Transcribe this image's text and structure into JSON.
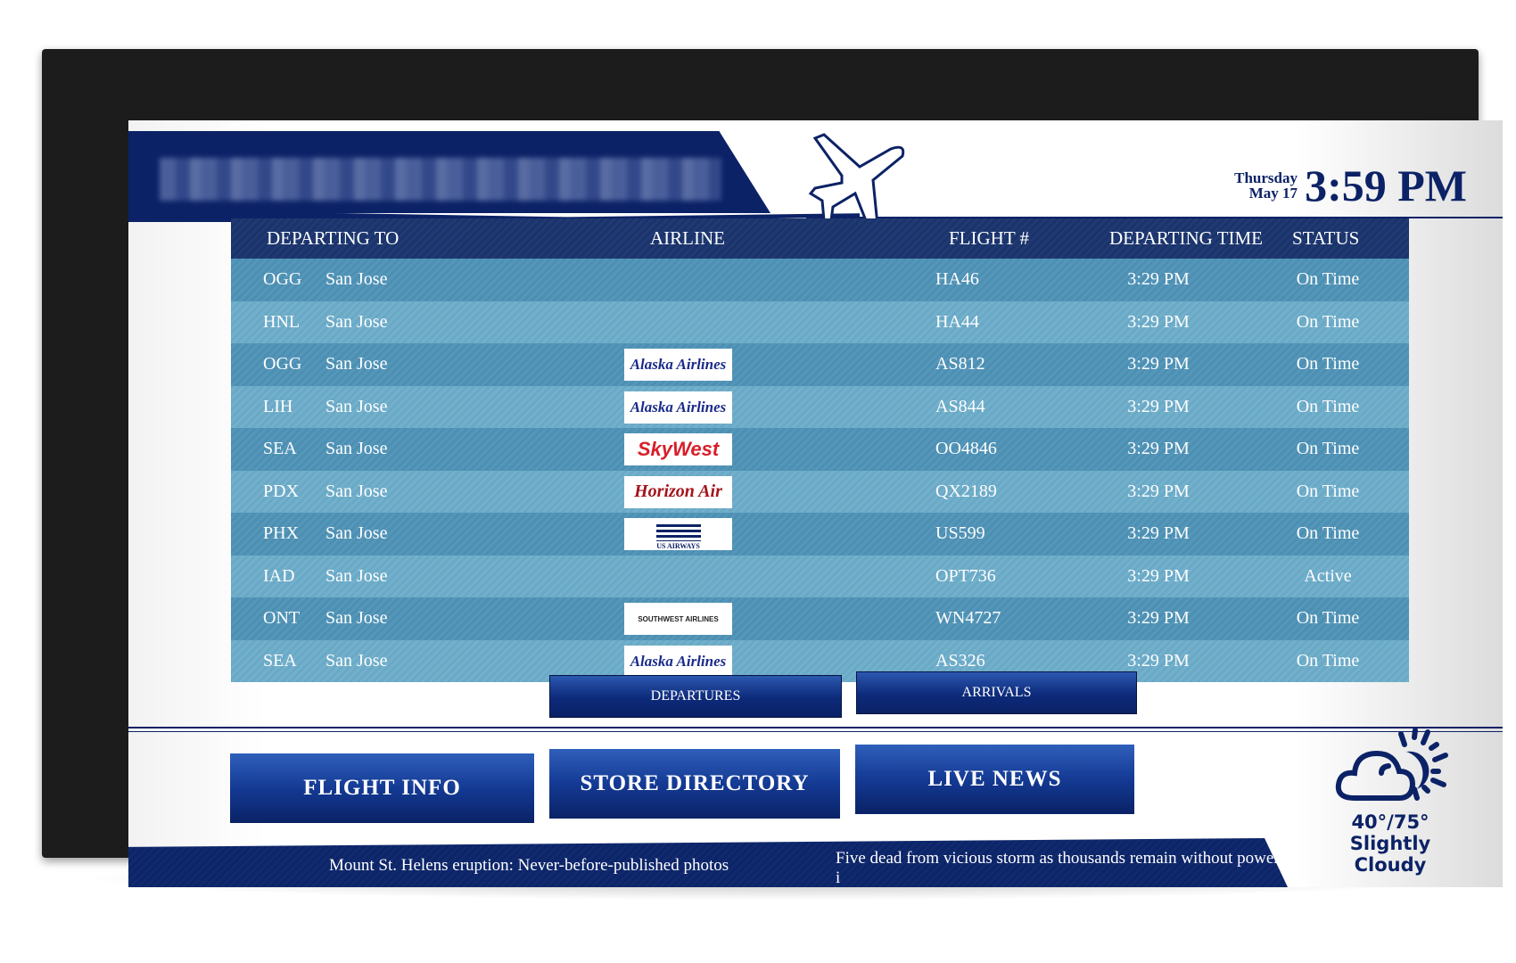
{
  "header": {
    "day": "Thursday",
    "date": "May 17",
    "time": "3:59 PM"
  },
  "table": {
    "columns": [
      "DEPARTING TO",
      "AIRLINE",
      "FLIGHT #",
      "DEPARTING TIME",
      "STATUS"
    ],
    "rows": [
      {
        "code": "OGG",
        "city": "San Jose",
        "airline": "",
        "flight": "HA46",
        "time": "3:29 PM",
        "status": "On Time"
      },
      {
        "code": "HNL",
        "city": "San Jose",
        "airline": "",
        "flight": "HA44",
        "time": "3:29 PM",
        "status": "On Time"
      },
      {
        "code": "OGG",
        "city": "San Jose",
        "airline": "Alaska Airlines",
        "flight": "AS812",
        "time": "3:29 PM",
        "status": "On Time"
      },
      {
        "code": "LIH",
        "city": "San Jose",
        "airline": "Alaska Airlines",
        "flight": "AS844",
        "time": "3:29 PM",
        "status": "On Time"
      },
      {
        "code": "SEA",
        "city": "San Jose",
        "airline": "SkyWest",
        "flight": "OO4846",
        "time": "3:29 PM",
        "status": "On Time"
      },
      {
        "code": "PDX",
        "city": "San Jose",
        "airline": "Horizon Air",
        "flight": "QX2189",
        "time": "3:29 PM",
        "status": "On Time"
      },
      {
        "code": "PHX",
        "city": "San Jose",
        "airline": "US AIRWAYS",
        "flight": "US599",
        "time": "3:29 PM",
        "status": "On Time"
      },
      {
        "code": "IAD",
        "city": "San Jose",
        "airline": "",
        "flight": "OPT736",
        "time": "3:29 PM",
        "status": "Active"
      },
      {
        "code": "ONT",
        "city": "San Jose",
        "airline": "SOUTHWEST AIRLINES",
        "flight": "WN4727",
        "time": "3:29 PM",
        "status": "On Time"
      },
      {
        "code": "SEA",
        "city": "San Jose",
        "airline": "Alaska Airlines",
        "flight": "AS326",
        "time": "3:29 PM",
        "status": "On Time"
      }
    ]
  },
  "tabs": {
    "departures": "DEPARTURES",
    "arrivals": "ARRIVALS"
  },
  "nav": {
    "flight_info": "FLIGHT INFO",
    "store_directory": "STORE DIRECTORY",
    "live_news": "LIVE NEWS"
  },
  "weather": {
    "icon": "partly-cloudy-icon",
    "temp": "40°/75°",
    "condition": "Slightly Cloudy"
  },
  "ticker": [
    "Mount St. Helens eruption: Never-before-published photos",
    "Five dead from vicious storm as thousands remain without power i"
  ],
  "colors": {
    "navy": "#0c2266",
    "row_dark": "#5597b9",
    "row_light": "#73b0cc",
    "alaska": "#1a2a8a",
    "skywest": "#d81e2a",
    "horizon": "#a3141c"
  }
}
